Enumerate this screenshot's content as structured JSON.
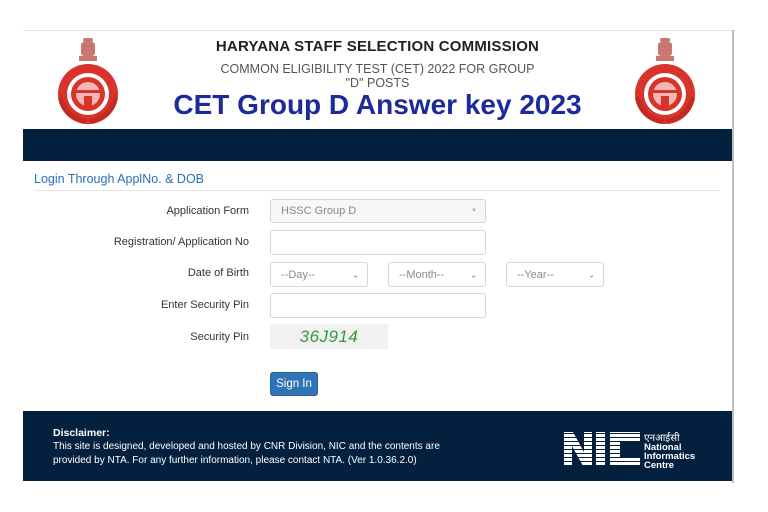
{
  "header": {
    "title": "HARYANA STAFF SELECTION COMMISSION",
    "subtitle_line1": "COMMON ELIGIBILITY TEST (CET) 2022 FOR GROUP",
    "subtitle_line2": "\"D\" POSTS",
    "overlay_title": "CET Group D Answer key 2023",
    "emblem_icon": "haryana-emblem-icon"
  },
  "colors": {
    "navy": "#03203f",
    "overlay_blue": "#1c2a9a",
    "heading_blue": "#2c6fb7",
    "button_blue": "#2f74b7",
    "captcha_green": "#2f9c3a",
    "emblem_red": "#d9342b"
  },
  "login": {
    "heading": "Login Through ApplNo. & DOB",
    "fields": {
      "application_form": {
        "label": "Application Form",
        "value": "HSSC Group D"
      },
      "registration_no": {
        "label": "Registration/ Application No",
        "value": "",
        "placeholder": ""
      },
      "dob": {
        "label": "Date of Birth",
        "day": "--Day--",
        "month": "--Month--",
        "year": "--Year--"
      },
      "security_pin_input": {
        "label": "Enter Security Pin",
        "value": "",
        "placeholder": ""
      },
      "security_pin": {
        "label": "Security Pin",
        "captcha": "36J914"
      }
    },
    "sign_in_label": "Sign In"
  },
  "footer": {
    "disclaimer_title": "Disclaimer:",
    "disclaimer_text": "This site is designed, developed and hosted by CNR Division, NIC and the contents are provided by NTA. For any further information, please contact NTA. (Ver 1.0.36.2.0)",
    "nic_logo": {
      "letters": "NIC",
      "hindi": "एनआईसी",
      "line1": "National",
      "line2": "Informatics",
      "line3": "Centre"
    }
  }
}
